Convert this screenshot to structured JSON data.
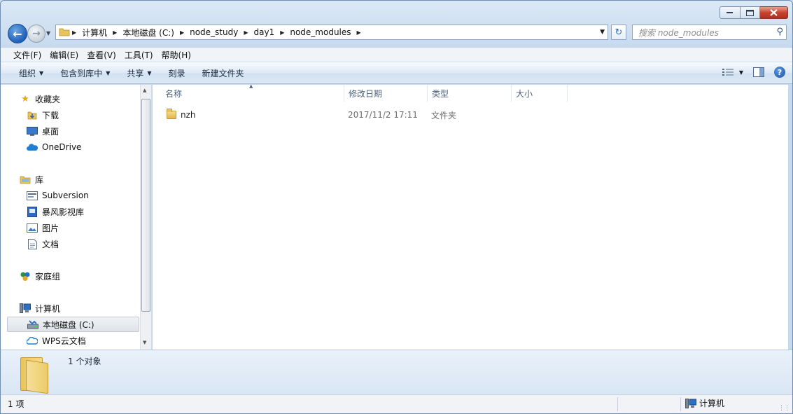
{
  "window": {
    "caption_buttons": [
      "minimize",
      "maximize",
      "close"
    ]
  },
  "address": {
    "breadcrumbs": [
      "计算机",
      "本地磁盘 (C:)",
      "node_study",
      "day1",
      "node_modules"
    ]
  },
  "search": {
    "placeholder": "搜索 node_modules"
  },
  "menu": {
    "items": [
      "文件(F)",
      "编辑(E)",
      "查看(V)",
      "工具(T)",
      "帮助(H)"
    ]
  },
  "toolbar": {
    "organize": "组织",
    "include_in_library": "包含到库中",
    "share": "共享",
    "burn": "刻录",
    "new_folder": "新建文件夹"
  },
  "nav": {
    "favorites": "收藏夹",
    "downloads": "下载",
    "desktop": "桌面",
    "onedrive": "OneDrive",
    "libraries": "库",
    "subversion": "Subversion",
    "baofeng": "暴风影视库",
    "pictures": "图片",
    "documents": "文档",
    "homegroup": "家庭组",
    "computer": "计算机",
    "local_disk": "本地磁盘 (C:)",
    "wps_cloud": "WPS云文档"
  },
  "columns": {
    "name": "名称",
    "modified": "修改日期",
    "type": "类型",
    "size": "大小"
  },
  "files": [
    {
      "name": "nzh",
      "modified": "2017/11/2 17:11",
      "type": "文件夹",
      "size": ""
    }
  ],
  "details": {
    "summary": "1 个对象"
  },
  "status": {
    "count": "1 项",
    "location": "计算机"
  },
  "colors": {
    "accent": "#1f5fb8",
    "close_button": "#c8432f",
    "folder": "#e7c466"
  }
}
